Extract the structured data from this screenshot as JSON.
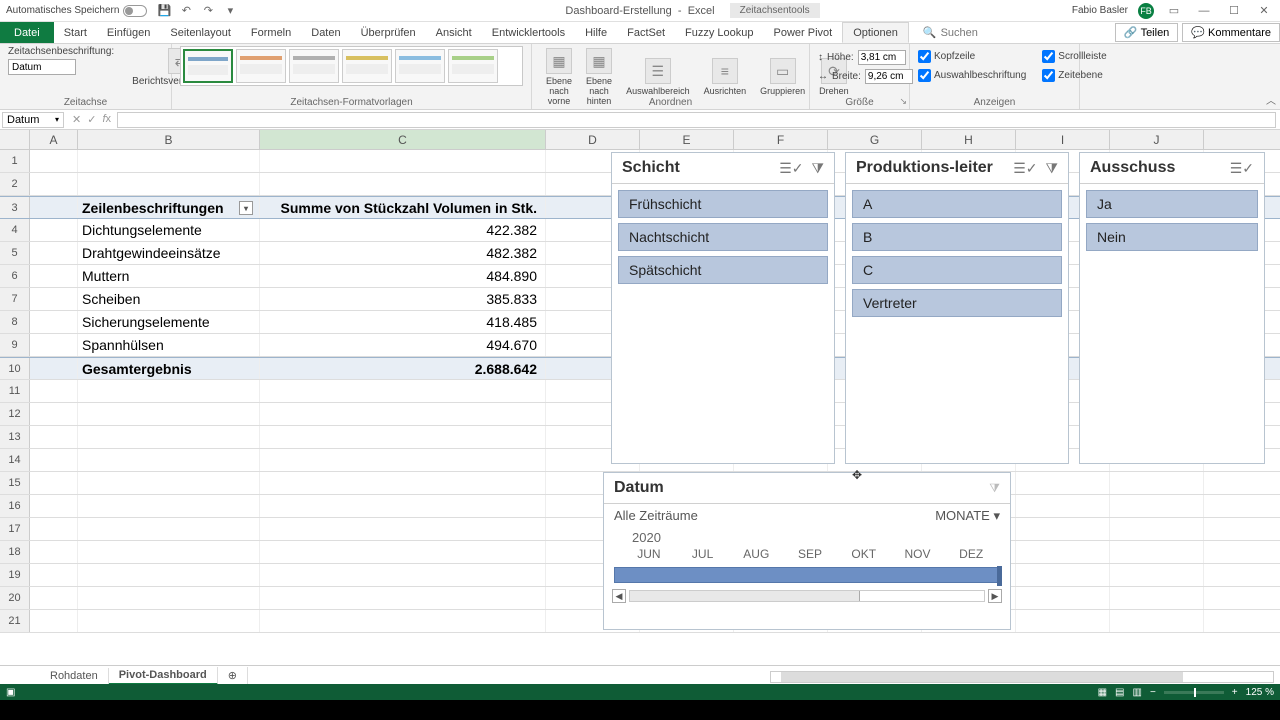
{
  "titlebar": {
    "autosave_label": "Automatisches Speichern",
    "doc": "Dashboard-Erstellung",
    "app": "Excel",
    "tool_tab": "Zeitachsentools",
    "user": "Fabio Basler",
    "initials": "FB"
  },
  "tabs": {
    "file": "Datei",
    "items": [
      "Start",
      "Einfügen",
      "Seitenlayout",
      "Formeln",
      "Daten",
      "Überprüfen",
      "Ansicht",
      "Entwicklertools",
      "Hilfe",
      "FactSet",
      "Fuzzy Lookup",
      "Power Pivot",
      "Optionen"
    ],
    "active": "Optionen",
    "search": "Suchen",
    "share": "Teilen",
    "comments": "Kommentare"
  },
  "ribbon": {
    "caption_label": "Zeitachsenbeschriftung:",
    "caption_value": "Datum",
    "report_conn": "Berichtsverbindungen",
    "g_axis": "Zeitachse",
    "g_styles": "Zeitachsen-Formatvorlagen",
    "arrange": [
      "Ebene nach vorne",
      "Ebene nach hinten",
      "Auswahlbereich",
      "Ausrichten",
      "Gruppieren",
      "Drehen"
    ],
    "g_arrange": "Anordnen",
    "height_label": "Höhe:",
    "height_val": "3,81 cm",
    "width_label": "Breite:",
    "width_val": "9,26 cm",
    "g_size": "Größe",
    "chk_header": "Kopfzeile",
    "chk_scroll": "Scrollleiste",
    "chk_sel": "Auswahlbeschriftung",
    "chk_time": "Zeitebene",
    "g_show": "Anzeigen"
  },
  "fbar": {
    "name": "Datum"
  },
  "cols": [
    "A",
    "B",
    "C",
    "D",
    "E",
    "F",
    "G",
    "H",
    "I",
    "J"
  ],
  "table": {
    "h1": "Zeilenbeschriftungen",
    "h2": "Summe von Stückzahl Volumen in Stk.",
    "rows": [
      {
        "label": "Dichtungselemente",
        "val": "422.382"
      },
      {
        "label": "Drahtgewindeeinsätze",
        "val": "482.382"
      },
      {
        "label": "Muttern",
        "val": "484.890"
      },
      {
        "label": "Scheiben",
        "val": "385.833"
      },
      {
        "label": "Sicherungselemente",
        "val": "418.485"
      },
      {
        "label": "Spannhülsen",
        "val": "494.670"
      }
    ],
    "total_label": "Gesamtergebnis",
    "total_val": "2.688.642"
  },
  "slicers": {
    "schicht": {
      "title": "Schicht",
      "items": [
        "Frühschicht",
        "Nachtschicht",
        "Spätschicht"
      ]
    },
    "leiter": {
      "title": "Produktions-leiter",
      "items": [
        "A",
        "B",
        "C",
        "Vertreter"
      ]
    },
    "ausschuss": {
      "title": "Ausschuss",
      "items": [
        "Ja",
        "Nein"
      ]
    }
  },
  "timeline": {
    "title": "Datum",
    "range": "Alle Zeiträume",
    "level": "MONATE",
    "year": "2020",
    "months": [
      "JUN",
      "JUL",
      "AUG",
      "SEP",
      "OKT",
      "NOV",
      "DEZ"
    ]
  },
  "sheets": {
    "items": [
      "Rohdaten",
      "Pivot-Dashboard"
    ],
    "active": "Pivot-Dashboard"
  },
  "status": {
    "zoom": "125 %"
  }
}
